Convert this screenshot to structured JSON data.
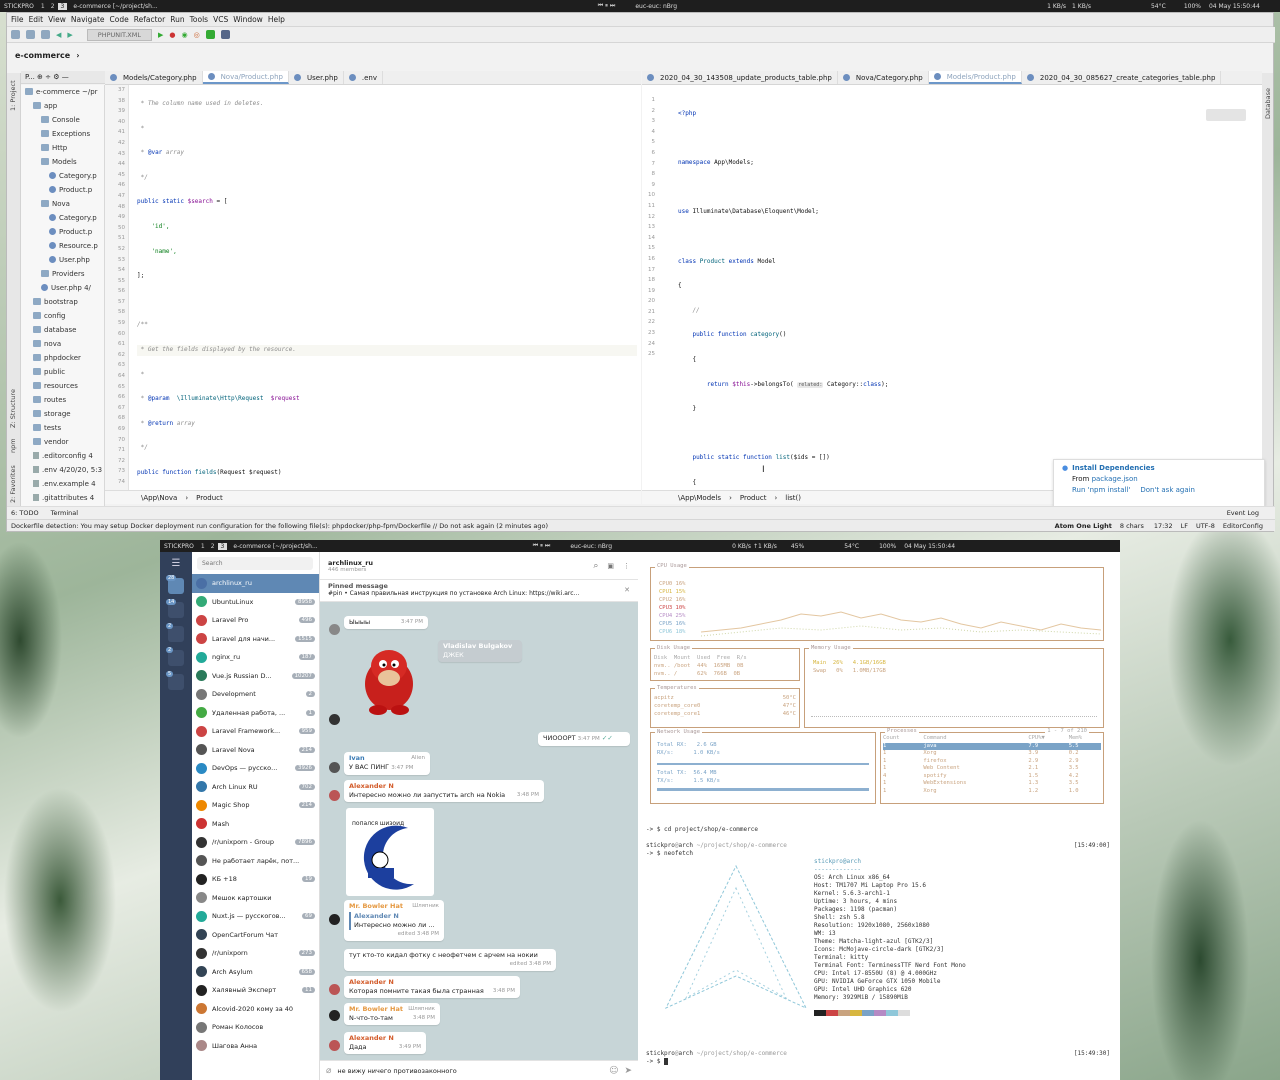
{
  "top_bar": {
    "workspace_name": "STICKPRO",
    "ws1": "1",
    "ws2": "2",
    "ws3": "3",
    "window_title": "e-commerce [~/project/sh...",
    "media": "euc-euc: nBrg",
    "net_down": "1 KB/s",
    "net_up": "1 KB/s",
    "temp": "54°C",
    "battery": "100%",
    "clock": "04 May 15:50:44"
  },
  "ide": {
    "menu": [
      "File",
      "Edit",
      "View",
      "Navigate",
      "Code",
      "Refactor",
      "Run",
      "Tools",
      "VCS",
      "Window",
      "Help"
    ],
    "run_config": "PHPUNIT.XML",
    "project_crumb": "e-commerce",
    "left_strip": [
      "1: Project",
      "Z: Structure",
      "npm",
      "2: Favorites"
    ],
    "right_strip": "Database",
    "tree": [
      {
        "t": "e-commerce ~/pr",
        "k": "fold",
        "d": 0
      },
      {
        "t": "app",
        "k": "fold",
        "d": 1
      },
      {
        "t": "Console",
        "k": "fold",
        "d": 2
      },
      {
        "t": "Exceptions",
        "k": "fold",
        "d": 2
      },
      {
        "t": "Http",
        "k": "fold",
        "d": 2
      },
      {
        "t": "Models",
        "k": "fold",
        "d": 2
      },
      {
        "t": "Category.p",
        "k": "php",
        "d": 3
      },
      {
        "t": "Product.p",
        "k": "php",
        "d": 3
      },
      {
        "t": "Nova",
        "k": "fold",
        "d": 2
      },
      {
        "t": "Category.p",
        "k": "php",
        "d": 3
      },
      {
        "t": "Product.p",
        "k": "php",
        "d": 3
      },
      {
        "t": "Resource.p",
        "k": "php",
        "d": 3
      },
      {
        "t": "User.php",
        "k": "php",
        "d": 3
      },
      {
        "t": "Providers",
        "k": "fold",
        "d": 2
      },
      {
        "t": "User.php  4/",
        "k": "php",
        "d": 2
      },
      {
        "t": "bootstrap",
        "k": "fold",
        "d": 1
      },
      {
        "t": "config",
        "k": "fold",
        "d": 1
      },
      {
        "t": "database",
        "k": "fold",
        "d": 1
      },
      {
        "t": "nova",
        "k": "fold",
        "d": 1
      },
      {
        "t": "phpdocker",
        "k": "fold",
        "d": 1
      },
      {
        "t": "public",
        "k": "fold",
        "d": 1
      },
      {
        "t": "resources",
        "k": "fold",
        "d": 1
      },
      {
        "t": "routes",
        "k": "fold",
        "d": 1
      },
      {
        "t": "storage",
        "k": "fold",
        "d": 1
      },
      {
        "t": "tests",
        "k": "fold",
        "d": 1
      },
      {
        "t": "vendor",
        "k": "fold",
        "d": 1
      },
      {
        "t": ".editorconfig  4",
        "k": "txt",
        "d": 1
      },
      {
        "t": ".env  4/20/20, 5:3",
        "k": "txt",
        "d": 1
      },
      {
        "t": ".env.example  4",
        "k": "txt",
        "d": 1
      },
      {
        "t": ".gitattributes  4",
        "k": "txt",
        "d": 1
      }
    ],
    "left_tabs": [
      "Models/Category.php",
      "Nova/Product.php",
      "User.php",
      ".env"
    ],
    "right_tabs": [
      "2020_04_30_143508_update_products_table.php",
      "Nova/Category.php",
      "Models/Product.php",
      "2020_04_30_085627_create_categories_table.php"
    ],
    "left_crumbs": [
      "\\App\\Nova",
      "Product"
    ],
    "right_crumbs": [
      "\\App\\Models",
      "Product",
      "list()"
    ],
    "left_start_line": 37,
    "right_start_line": 1,
    "notification": {
      "title": "Install Dependencies",
      "body_prefix": "From",
      "body_link": "package.json",
      "action1": "Run 'npm install'",
      "action2": "Don't ask again"
    },
    "status_msg": "Dockerfile detection: You may setup Docker deployment run configuration for the following file(s): phpdocker/php-fpm/Dockerfile // Do not ask again (2 minutes ago)",
    "status_right": [
      "Atom One Light",
      "8 chars",
      "17:32",
      "LF",
      "UTF-8",
      "EditorConfig"
    ],
    "bottom_tabs": [
      "6: TODO",
      "Terminal"
    ],
    "event_log": "Event Log"
  },
  "top_bar2": {
    "workspace_name": "STICKPRO",
    "window_title": "e-commerce [~/project/sh...",
    "media": "euc-euc: nBrg",
    "net": "0 KB/s  ↑1 KB/s",
    "vol": "45%",
    "temp": "54°C",
    "battery": "100%",
    "clock": "04 May 15:50:44"
  },
  "telegram": {
    "search_placeholder": "Search",
    "chat_title": "archlinux_ru",
    "members": "446 members",
    "pinned_label": "Pinned message",
    "pinned_text": "#pin • Самая правильная инструкция по установке Arch Linux: https://wiki.arc...",
    "folder_badges": [
      "28",
      "14",
      "2",
      "2",
      "5"
    ],
    "chats": [
      [
        "archlinux_ru",
        ""
      ],
      [
        "UbuntuLinux",
        "8958"
      ],
      [
        "Laravel Pro",
        "496"
      ],
      [
        "Laravel для начи...",
        "1515"
      ],
      [
        "nginx_ru",
        "187"
      ],
      [
        "Vue.js Russian D...",
        "10207"
      ],
      [
        "Development",
        "2"
      ],
      [
        "Удаленная работа, ...",
        "1"
      ],
      [
        "Laravel Framework...",
        "959"
      ],
      [
        "Laravel Nova",
        "214"
      ],
      [
        "DevOps — русско...",
        "3926"
      ],
      [
        "Arch Linux RU",
        "702"
      ],
      [
        "Magic Shop",
        "214"
      ],
      [
        "Mash",
        ""
      ],
      [
        "/r/unixporn - Group",
        "7896"
      ],
      [
        "Не работает ларёк, пот...",
        ""
      ],
      [
        "КБ +18",
        "19"
      ],
      [
        "Мешок картошки",
        ""
      ],
      [
        "Nuxt.js — русскогов...",
        "69"
      ],
      [
        "OpenCartForum Чат",
        ""
      ],
      [
        "/r/unixporn",
        "273"
      ],
      [
        "Arch Asylum",
        "658"
      ],
      [
        "Халявный Эксперт",
        "11"
      ],
      [
        "Alcovid-2020 кому за 40",
        ""
      ],
      [
        "Роман Колосов",
        ""
      ],
      [
        "Шагова Анна",
        ""
      ]
    ],
    "msgs": {
      "m1_text": "Ыыыы",
      "m1_time": "3:47 PM",
      "m2_name": "Vladislav Bulgakov",
      "m2_text": "ДЖЕК",
      "m3_text": "ЧИОООРТ",
      "m3_time": "3:47 PM",
      "m4_name": "Ivan",
      "m4_tag": "Alien",
      "m4_text": "У ВАС ПИНГ",
      "m4_time": "3:47 PM",
      "m5_name": "Alexander N",
      "m5_text": "Интересно можно ли запустить arch на Nokia",
      "m5_time": "3:48 PM",
      "m6_text": "попался шизоид",
      "m7_name": "Mr. Bowler Hat",
      "m7_tag": "Шляпник",
      "m7_rname": "Alexander N",
      "m7_rtext": "Интересно можно ли ...",
      "m7_time": "edited 3:48 PM",
      "m8_text": "тут кто-то кидал фотку с неофетчем с арчем на нокии",
      "m8_time": "edited 3:48 PM",
      "m9_name": "Alexander N",
      "m9_text": "Которая помните такая была странная",
      "m9_time": "3:48 PM",
      "m10_name": "Mr. Bowler Hat",
      "m10_tag": "Шляпник",
      "m10_text": "N-что-то-там",
      "m10_time": "3:48 PM",
      "m11_name": "Alexander N",
      "m11_text": "Дада",
      "m11_time": "3:49 PM"
    },
    "input_text": "не вижу ничего противозаконного"
  },
  "monitor": {
    "cpu_title": "CPU Usage",
    "cpu_lines": [
      "CPU0 16%",
      "CPU1 15%",
      "CPU2 16%",
      "CPU3 10%",
      "CPU4 25%",
      "CPU5 16%",
      "CPU6 18%"
    ],
    "disk_title": "Disk Usage",
    "disk_head": "Disk  Mount  Used  Free  R/s",
    "disk_rows": [
      "nvm.. /boot  44%  165MB  0B",
      "nvm.. /      62%  766B  0B"
    ],
    "mem_title": "Memory Usage",
    "mem_main": "Main  26%   4.1GB/16GB",
    "mem_swap": "Swap   0%   1.0MB/17GB",
    "temp_title": "Temperatures",
    "temps": [
      [
        "acpitz",
        "50°C"
      ],
      [
        "coretemp_core0",
        "47°C"
      ],
      [
        "coretemp_core1",
        "46°C"
      ]
    ],
    "net_title": "Network Usage",
    "net_rows": [
      "Total RX:   2.6 GB",
      "RX/s:      1.0 KB/s",
      "Total TX:  56.4 MB",
      "TX/s:      1.5 KB/s"
    ],
    "proc_title": "Processes",
    "proc_count": "1 - 7 of 210",
    "proc_head": [
      "Count",
      "Command",
      "CPU%▼",
      "Mem%"
    ],
    "procs": [
      [
        "1",
        "java",
        "7.9",
        "5.5"
      ],
      [
        "1",
        "Xorg",
        "3.9",
        "0.2"
      ],
      [
        "1",
        "firefox",
        "2.9",
        "2.9"
      ],
      [
        "1",
        "Web Content",
        "2.1",
        "3.5"
      ],
      [
        "4",
        "spotify",
        "1.5",
        "4.2"
      ],
      [
        "1",
        "WebExtensions",
        "1.3",
        "3.5"
      ],
      [
        "1",
        "Xorg",
        "1.2",
        "1.0"
      ]
    ]
  },
  "terminal": {
    "cmd1": "-> $ cd project/shop/e-commerce",
    "prompt_user": "stickpro",
    "prompt_host": "arch",
    "prompt_path": " ~/project/shop/e-commerce",
    "time1": "[15:49:00]",
    "cmd2": "-> $ neofetch",
    "header": "stickpro@arch",
    "info": [
      "OS: Arch Linux x86_64",
      "Host: TM1707 Mi Laptop Pro 15.6",
      "Kernel: 5.6.3-arch1-1",
      "Uptime: 3 hours, 4 mins",
      "Packages: 1198 (pacman)",
      "Shell: zsh 5.8",
      "Resolution: 1920x1080, 2560x1080",
      "WM: i3",
      "Theme: Matcha-light-azul [GTK2/3]",
      "Icons: McMojave-circle-dark [GTK2/3]",
      "Terminal: kitty",
      "Terminal Font: TerminessTTF Nerd Font Mono",
      "CPU: Intel i7-8550U (8) @ 4.000GHz",
      "GPU: NVIDIA GeForce GTX 1050 Mobile",
      "GPU: Intel UHD Graphics 620",
      "Memory: 3929MiB / 15890MiB"
    ],
    "time2": "[15:49:30]",
    "cmd3": "-> $"
  }
}
